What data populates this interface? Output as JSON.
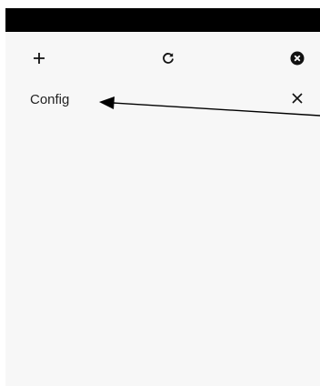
{
  "toolbar": {
    "add_icon": "plus-icon",
    "refresh_icon": "refresh-icon",
    "close_all_icon": "close-circle-icon"
  },
  "list": {
    "items": [
      {
        "label": "Config",
        "remove_icon": "close-icon"
      }
    ]
  },
  "colors": {
    "status_bar": "#000000",
    "panel_background": "#f7f7f7",
    "text": "#222222",
    "icon": "#111111"
  }
}
